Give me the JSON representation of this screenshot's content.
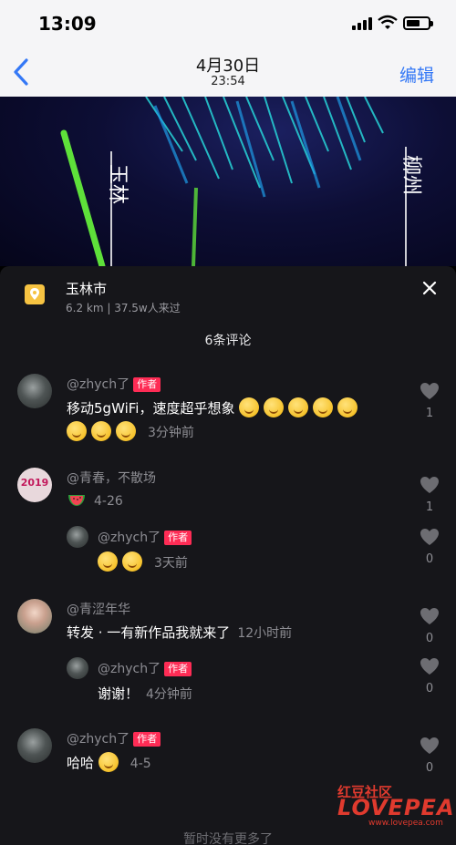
{
  "status": {
    "time": "13:09"
  },
  "nav": {
    "date": "4月30日",
    "time": "23:54",
    "edit": "编辑"
  },
  "video": {
    "text_left": "玉林",
    "text_right": "柳州"
  },
  "location": {
    "name": "玉林市",
    "meta": "6.2 km | 37.5w人来过"
  },
  "comment_count": "6条评论",
  "comments": [
    {
      "user": "@zhych了",
      "tag": "作者",
      "text": "移动5gWiFi，速度超乎想象",
      "time": "3分钟前",
      "likes": "1"
    },
    {
      "user": "@青春，不散场",
      "text": "",
      "time": "4-26",
      "likes": "1",
      "reply": {
        "user": "@zhych了",
        "tag": "作者",
        "time": "3天前",
        "likes": "0"
      }
    },
    {
      "user": "@青涩年华",
      "text": "转发 · 一有新作品我就来了",
      "time": "12小时前",
      "likes": "0",
      "reply": {
        "user": "@zhych了",
        "tag": "作者",
        "text": "谢谢！",
        "time": "4分钟前",
        "likes": "0"
      }
    },
    {
      "user": "@zhych了",
      "tag": "作者",
      "text": "哈哈",
      "time": "4-5",
      "likes": "0"
    }
  ],
  "avatar_b_text": "2019",
  "footer": "暂时没有更多了",
  "watermark": {
    "line1": "红豆社区",
    "line2": "LOVEPEA",
    "line3": "www.lovepea.com"
  },
  "colors": {
    "accent": "#3478f6",
    "author_tag": "#fe2c55",
    "location_icon": "#f6c342"
  }
}
